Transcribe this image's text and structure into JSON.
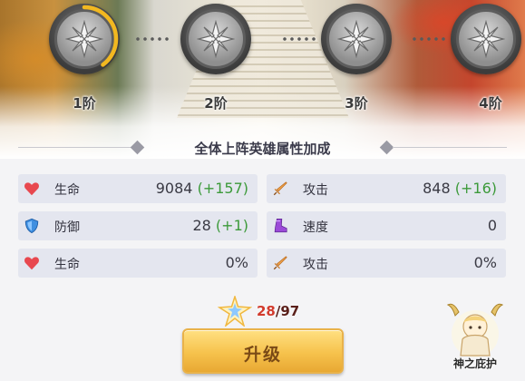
{
  "stages": [
    {
      "label": "1阶",
      "progress": 0.4,
      "color": "#f2b820"
    },
    {
      "label": "2阶",
      "progress": 0,
      "color": "#f2b820"
    },
    {
      "label": "3阶",
      "progress": 0,
      "color": "#f2b820"
    },
    {
      "label": "4阶",
      "progress": 0,
      "color": "#f2b820"
    }
  ],
  "section_title": "全体上阵英雄属性加成",
  "stats": [
    {
      "icon": "heart-icon",
      "name": "生命",
      "value": "9084",
      "bonus": "(+157)"
    },
    {
      "icon": "sword-icon",
      "name": "攻击",
      "value": "848",
      "bonus": "(+16)"
    },
    {
      "icon": "shield-icon",
      "name": "防御",
      "value": "28",
      "bonus": "(+1)"
    },
    {
      "icon": "boot-icon",
      "name": "速度",
      "value": "0",
      "bonus": ""
    },
    {
      "icon": "heart-icon",
      "name": "生命",
      "value": "0%",
      "bonus": ""
    },
    {
      "icon": "sword-icon",
      "name": "攻击",
      "value": "0%",
      "bonus": ""
    }
  ],
  "cost": {
    "have": "28",
    "separator": "/",
    "need": "97"
  },
  "upgrade_label": "升级",
  "blessing_label": "神之庇护",
  "colors": {
    "bonus": "#3c9a3a",
    "cost_have": "#d23b2d",
    "progress": "#f2b820"
  }
}
